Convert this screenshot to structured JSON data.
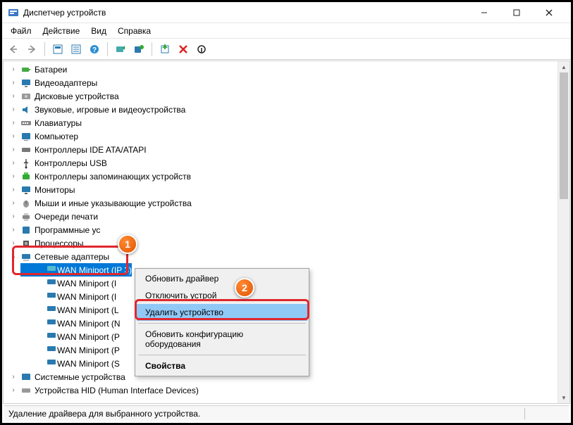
{
  "window": {
    "title": "Диспетчер устройств"
  },
  "menu": {
    "file": "Файл",
    "action": "Действие",
    "view": "Вид",
    "help": "Справка"
  },
  "tree": {
    "categories": [
      {
        "label": "Батареи",
        "icon": "battery"
      },
      {
        "label": "Видеоадаптеры",
        "icon": "display"
      },
      {
        "label": "Дисковые устройства",
        "icon": "disk"
      },
      {
        "label": "Звуковые, игровые и видеоустройства",
        "icon": "audio"
      },
      {
        "label": "Клавиатуры",
        "icon": "keyboard"
      },
      {
        "label": "Компьютер",
        "icon": "computer"
      },
      {
        "label": "Контроллеры IDE ATA/ATAPI",
        "icon": "ide"
      },
      {
        "label": "Контроллеры USB",
        "icon": "usb"
      },
      {
        "label": "Контроллеры запоминающих устройств",
        "icon": "storage"
      },
      {
        "label": "Мониторы",
        "icon": "monitor"
      },
      {
        "label": "Мыши и иные указывающие устройства",
        "icon": "mouse"
      },
      {
        "label": "Очереди печати",
        "icon": "printer"
      },
      {
        "label": "Программные ус",
        "icon": "software",
        "truncated": true
      },
      {
        "label": "Процессоры",
        "icon": "cpu",
        "truncated": true
      }
    ],
    "network": {
      "label": "Сетевые адаптеры",
      "children": [
        "WAN Miniport (I",
        "WAN Miniport (I",
        "WAN Miniport (I",
        "WAN Miniport (L",
        "WAN Miniport (N",
        "WAN Miniport (P",
        "WAN Miniport (P",
        "WAN Miniport (S"
      ],
      "selected_full": "WAN Miniport (IP   3)"
    },
    "after": [
      {
        "label": "Системные устройства",
        "icon": "system"
      },
      {
        "label": "Устройства HID (Human Interface Devices)",
        "icon": "hid"
      }
    ]
  },
  "context_menu": {
    "update": "Обновить драйвер",
    "disable": "Отключить устрой",
    "uninstall": "Удалить устройство",
    "scan": "Обновить конфигурацию оборудования",
    "props": "Свойства"
  },
  "badges": {
    "one": "1",
    "two": "2"
  },
  "status": {
    "text": "Удаление драйвера для выбранного устройства."
  }
}
